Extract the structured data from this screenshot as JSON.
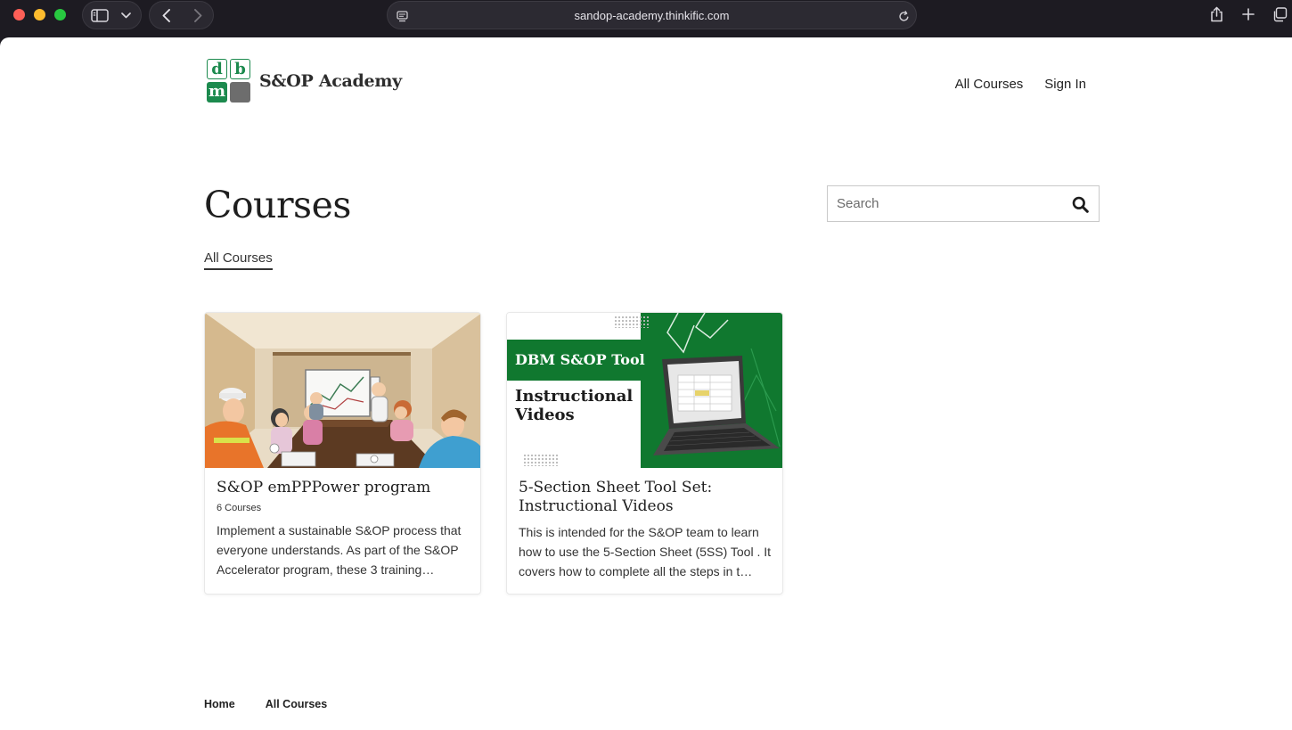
{
  "browser": {
    "url": "sandop-academy.thinkific.com"
  },
  "site": {
    "logo_letters": [
      "d",
      "b",
      "m"
    ],
    "name": "S&OP Academy",
    "brand_color": "#1c8a4e"
  },
  "topnav": {
    "all_courses": "All Courses",
    "sign_in": "Sign In"
  },
  "main": {
    "title": "Courses",
    "filter_tab": "All Courses",
    "search": {
      "placeholder": "Search"
    }
  },
  "cards": [
    {
      "title": "S&OP emPPPower program",
      "meta": "6 Courses",
      "description": "Implement a sustainable S&OP process that everyone understands. As part of the S&OP Accelerator program, these 3 training…"
    },
    {
      "title": "5-Section Sheet Tool Set: Instructional Videos",
      "meta": "",
      "description": "This is intended for the S&OP team to learn how to use the 5-Section Sheet (5SS) Tool . It covers how to complete all the steps in t…",
      "thumbnail": {
        "band_text": "DBM S&OP Tool",
        "heading": "Instructional Videos"
      }
    }
  ],
  "footer": {
    "home": "Home",
    "all_courses": "All Courses"
  }
}
